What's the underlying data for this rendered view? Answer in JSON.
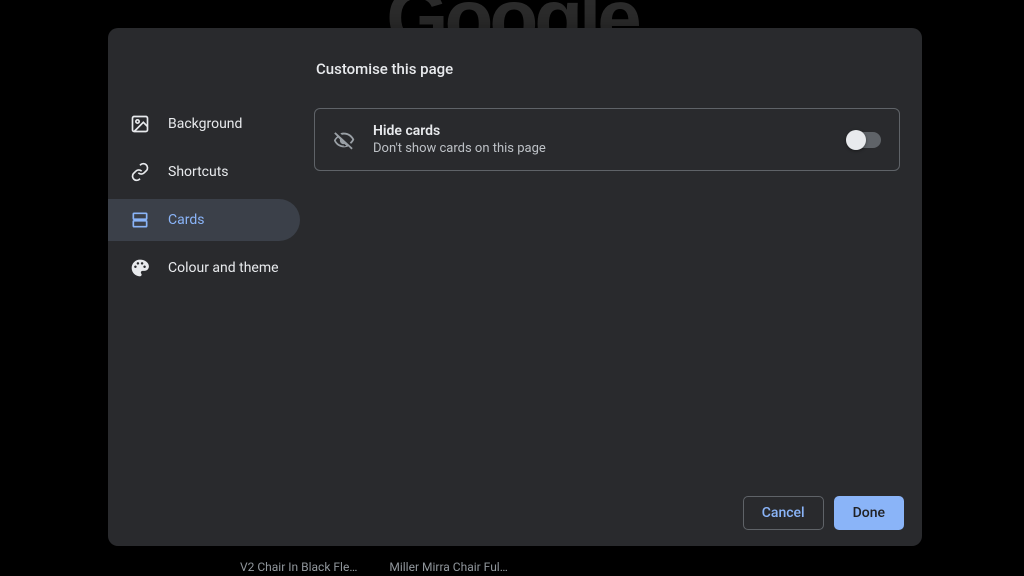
{
  "background": {
    "logo_text": "Google",
    "bottom_items": [
      "V2 Chair In Black Fle…",
      "Miller Mirra Chair Ful…"
    ]
  },
  "modal": {
    "title": "Customise this page",
    "sidebar": {
      "items": [
        {
          "label": "Background",
          "icon": "image-icon",
          "selected": false
        },
        {
          "label": "Shortcuts",
          "icon": "link-icon",
          "selected": false
        },
        {
          "label": "Cards",
          "icon": "cards-icon",
          "selected": true
        },
        {
          "label": "Colour and theme",
          "icon": "palette-icon",
          "selected": false
        }
      ]
    },
    "option": {
      "title": "Hide cards",
      "description": "Don't show cards on this page",
      "toggle_on": false
    },
    "footer": {
      "cancel": "Cancel",
      "done": "Done"
    }
  }
}
